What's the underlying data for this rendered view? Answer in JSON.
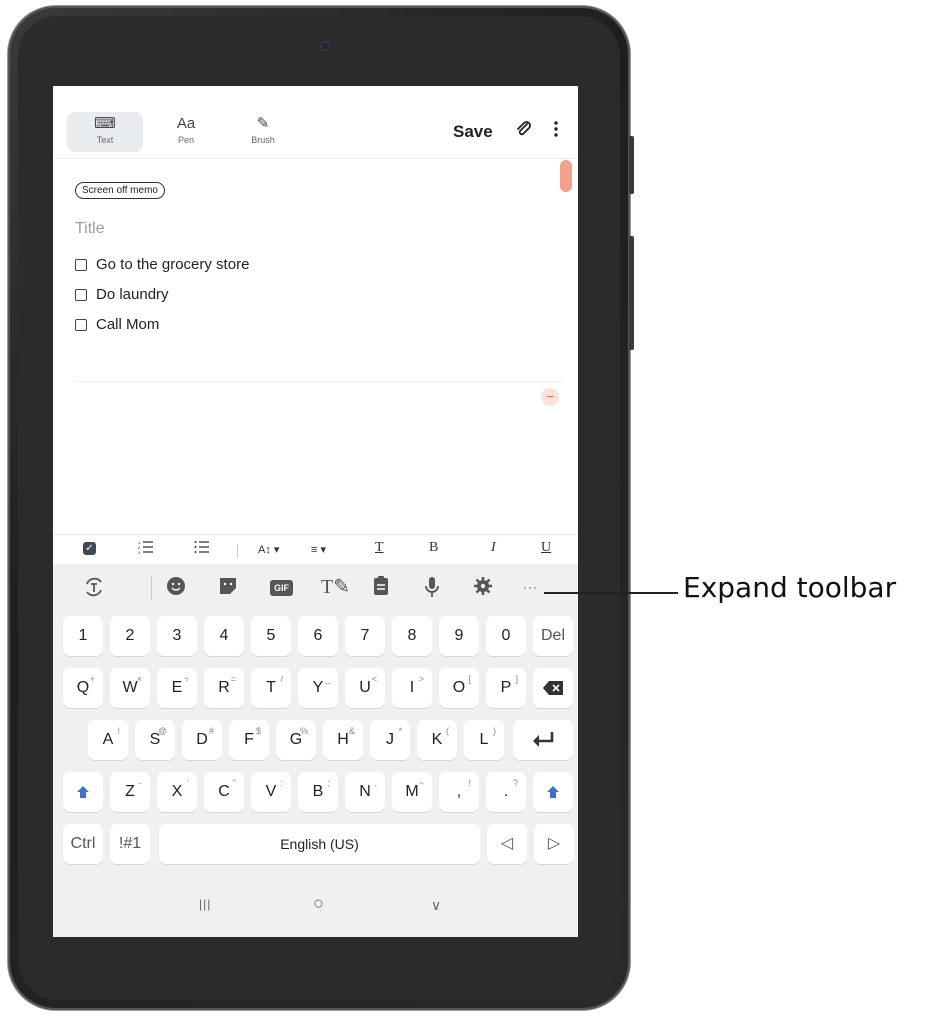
{
  "top_toolbar": {
    "modes": [
      {
        "label": "Text",
        "icon": "keyboard-icon",
        "glyph": "⌨"
      },
      {
        "label": "Pen",
        "icon": "pen-icon",
        "glyph": "Aa"
      },
      {
        "label": "Brush",
        "icon": "brush-icon",
        "glyph": "✎"
      }
    ],
    "save_label": "Save",
    "attach_icon": "paperclip-icon",
    "more_icon": "more-vertical-icon"
  },
  "note": {
    "tag": "Screen off memo",
    "title_placeholder": "Title",
    "checklist": [
      "Go to the grocery store",
      "Do laundry",
      "Call Mom"
    ]
  },
  "format_toolbar": {
    "items": [
      "checkbox-icon",
      "numbered-list-icon",
      "bulleted-list-icon",
      "font-size-icon",
      "align-icon",
      "text-color-icon",
      "bold-icon",
      "italic-icon",
      "underline-icon"
    ],
    "bold": "B",
    "italic": "I",
    "underline": "U",
    "text_color": "T"
  },
  "keyboard": {
    "toolbar_icons": [
      "translate-icon",
      "emoji-icon",
      "sticker-icon",
      "gif-icon",
      "handwriting-icon",
      "clipboard-icon",
      "mic-icon",
      "settings-icon",
      "expand-toolbar-icon"
    ],
    "gif_label": "GIF",
    "number_row": [
      "1",
      "2",
      "3",
      "4",
      "5",
      "6",
      "7",
      "8",
      "9",
      "0",
      "Del"
    ],
    "row1": [
      {
        "k": "Q",
        "s": "+"
      },
      {
        "k": "W",
        "s": "×"
      },
      {
        "k": "E",
        "s": "÷"
      },
      {
        "k": "R",
        "s": "="
      },
      {
        "k": "T",
        "s": "/"
      },
      {
        "k": "Y",
        "s": "_"
      },
      {
        "k": "U",
        "s": "<"
      },
      {
        "k": "I",
        "s": ">"
      },
      {
        "k": "O",
        "s": "["
      },
      {
        "k": "P",
        "s": "]"
      }
    ],
    "row2": [
      {
        "k": "A",
        "s": "!"
      },
      {
        "k": "S",
        "s": "@"
      },
      {
        "k": "D",
        "s": "#"
      },
      {
        "k": "F",
        "s": "$"
      },
      {
        "k": "G",
        "s": "%"
      },
      {
        "k": "H",
        "s": "&"
      },
      {
        "k": "J",
        "s": "*"
      },
      {
        "k": "K",
        "s": "("
      },
      {
        "k": "L",
        "s": ")"
      }
    ],
    "row3": [
      {
        "k": "Z",
        "s": "-"
      },
      {
        "k": "X",
        "s": "'"
      },
      {
        "k": "C",
        "s": "\""
      },
      {
        "k": "V",
        "s": ":"
      },
      {
        "k": "B",
        "s": ";"
      },
      {
        "k": "N",
        "s": ","
      },
      {
        "k": "M",
        "s": "~"
      },
      {
        "k": ",",
        "s": "!"
      },
      {
        "k": ".",
        "s": "?"
      }
    ],
    "ctrl_label": "Ctrl",
    "symbols_label": "!#1",
    "space_label": "English (US)",
    "left_arrow": "◁",
    "right_arrow": "▷"
  },
  "navbar": {
    "recents": "|||",
    "home": "○",
    "back": "∨"
  },
  "callout": {
    "label": "Expand toolbar"
  }
}
